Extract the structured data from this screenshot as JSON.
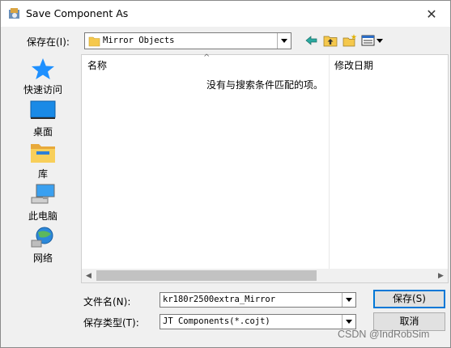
{
  "window": {
    "title": "Save Component As",
    "close_glyph": "✕"
  },
  "location": {
    "label": "保存在(I):",
    "value": "Mirror Objects"
  },
  "toolbar": {
    "icons": [
      "back-icon",
      "up-folder-icon",
      "new-folder-icon",
      "view-menu-icon"
    ]
  },
  "places": [
    {
      "label": "快速访问",
      "icon": "star-icon"
    },
    {
      "label": "桌面",
      "icon": "desktop-icon"
    },
    {
      "label": "库",
      "icon": "library-folder-icon"
    },
    {
      "label": "此电脑",
      "icon": "computer-icon"
    },
    {
      "label": "网络",
      "icon": "network-icon"
    }
  ],
  "filelist": {
    "col_name": "名称",
    "col_date": "修改日期",
    "empty_message": "没有与搜索条件匹配的项。"
  },
  "filename": {
    "label": "文件名(N):",
    "value": "kr180r2500extra_Mirror"
  },
  "filetype": {
    "label": "保存类型(T):",
    "value": "JT Components(*.cojt)"
  },
  "buttons": {
    "save": "保存(S)",
    "cancel": "取消"
  },
  "watermark": "CSDN @IndRobSim",
  "colors": {
    "accent": "#0078d7",
    "star": "#1e90ff",
    "folder": "#f5c84c"
  }
}
